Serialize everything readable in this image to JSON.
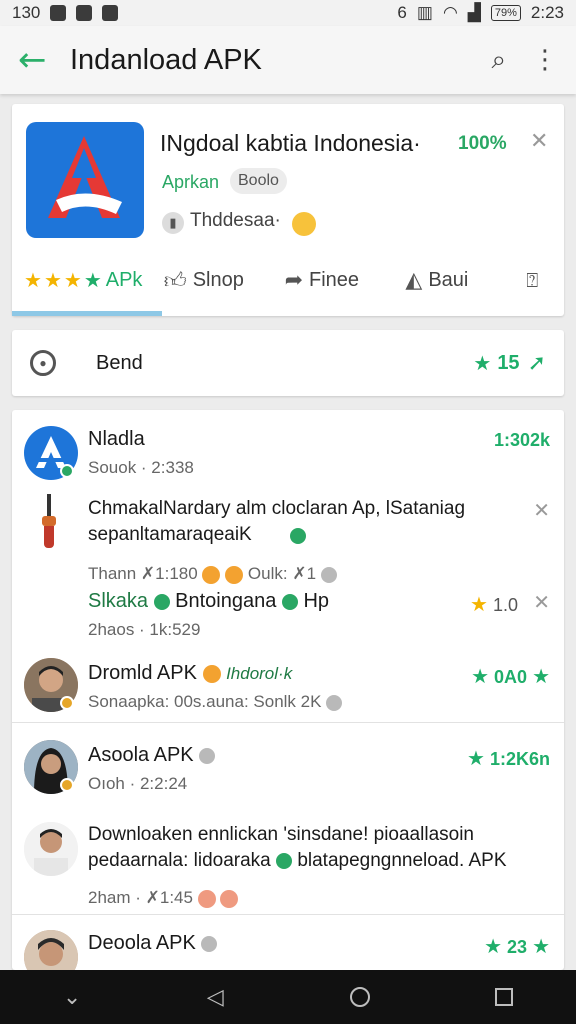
{
  "status_bar": {
    "time_left": "130",
    "time": "2:23",
    "signal_mark": "6",
    "battery": "79%"
  },
  "app_bar": {
    "title": "Indanload APK",
    "back_icon": "arrow-left-icon",
    "search_icon": "search-icon",
    "menu_icon": "more-vert-icon"
  },
  "hero": {
    "title": "INgdoal kabtia Indonesia·",
    "percent": "100%",
    "category": "Aprkan",
    "chip": "Boolo",
    "developer": "Thddesaa·",
    "rating_label": "APk",
    "stars_filled": 4,
    "actions": [
      {
        "icon": "thumb-up-icon",
        "label": "Slnop"
      },
      {
        "icon": "share-icon",
        "label": "Finee"
      },
      {
        "icon": "send-icon",
        "label": "Baui"
      }
    ],
    "report_icon": "report-icon",
    "accent": "#1fae6a"
  },
  "trend": {
    "label": "Bend",
    "count": "15"
  },
  "feed": [
    {
      "name": "Nladla",
      "meta": "Souok · 2:338",
      "right": "1:302k"
    },
    {
      "text": "ChmakalNardary alm cloclaran Ap, lSataniag sepanltamaraqeaiK",
      "meta": "Thann ✗1:180",
      "meta2": "Oulk: ✗1"
    },
    {
      "text": "Slkaka",
      "text2": "Bntoingana",
      "text3": "Hp",
      "meta": "2haos · 1k:529",
      "right": "1.0"
    },
    {
      "name": "Dromld APK",
      "tag": "Ihdorol·k",
      "meta": "Sonaapka: 00s.auna: Sonlk 2K",
      "right": "0A0"
    },
    {
      "name": "Asoola APK",
      "meta": "Oıoh · 2:2:24",
      "right": "1:2K6n"
    },
    {
      "text": "Downloaken ennlickan 'sinsdane! pioaallasoin pedaarnala: lidoaraka",
      "text2": "blatapegngnneload. APK",
      "meta": "2ham · ✗1:45"
    },
    {
      "name": "Deoola APK",
      "right": "23"
    }
  ]
}
